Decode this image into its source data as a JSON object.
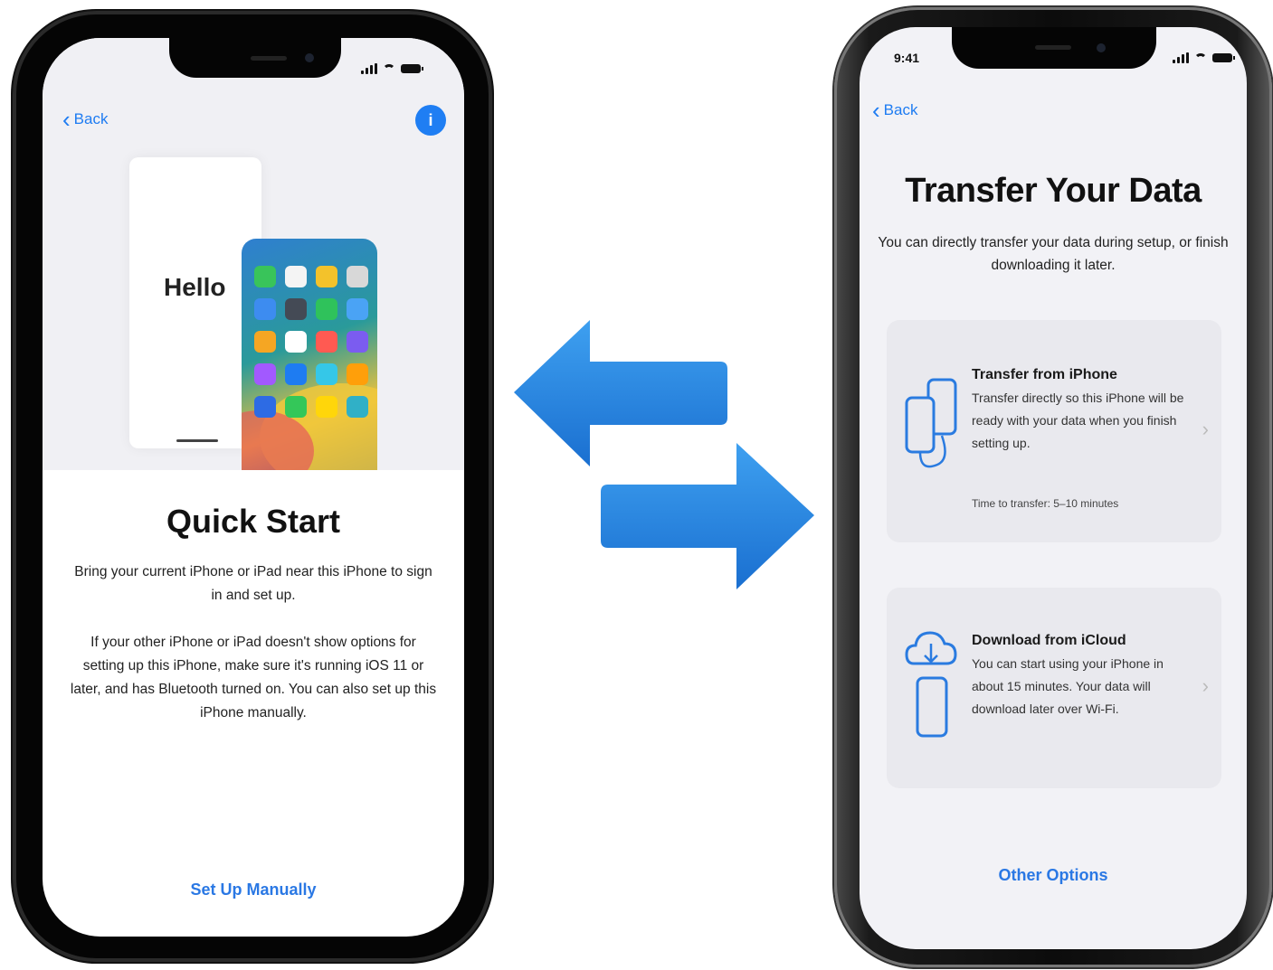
{
  "left_phone": {
    "status_time": "",
    "back_label": "Back",
    "info_label": "i",
    "hello_text": "Hello",
    "title": "Quick Start",
    "paragraph_1": "Bring your current iPhone or iPad near this iPhone to sign in and set up.",
    "paragraph_2": "If your other iPhone or iPad doesn't show options for setting up this iPhone, make sure it's running iOS 11 or later, and has Bluetooth turned on. You can also set up this iPhone manually.",
    "setup_manually_label": "Set Up Manually",
    "app_colors": [
      "#39c45a",
      "#f4f4f4",
      "#f3c22b",
      "#d8d8d8",
      "#3d8cf0",
      "#444a55",
      "#2fc25b",
      "#4aa3f5",
      "#f5a623",
      "#ffffff",
      "#ff5a52",
      "#7b5cf0",
      "#a259ff",
      "#1e7cf2",
      "#35c7e8",
      "#ff9f0a",
      "#2d6be4",
      "#34c759",
      "#ffd60a",
      "#30b0c7"
    ]
  },
  "right_phone": {
    "status_time": "9:41",
    "back_label": "Back",
    "title": "Transfer Your Data",
    "subtitle": "You can directly transfer your data during setup, or finish downloading it later.",
    "options": [
      {
        "title": "Transfer from iPhone",
        "description": "Transfer directly so this iPhone will be ready with your data when you finish setting up.",
        "meta": "Time to transfer: 5–10 minutes",
        "icon": "iphone-transfer-icon"
      },
      {
        "title": "Download from iCloud",
        "description": "You can start using your iPhone in about 15 minutes. Your data will download later over Wi-Fi.",
        "meta": "",
        "icon": "icloud-download-icon"
      }
    ],
    "other_options_label": "Other Options"
  },
  "colors": {
    "accent": "#1e7cf2",
    "arrow": "#1f7fdc"
  }
}
